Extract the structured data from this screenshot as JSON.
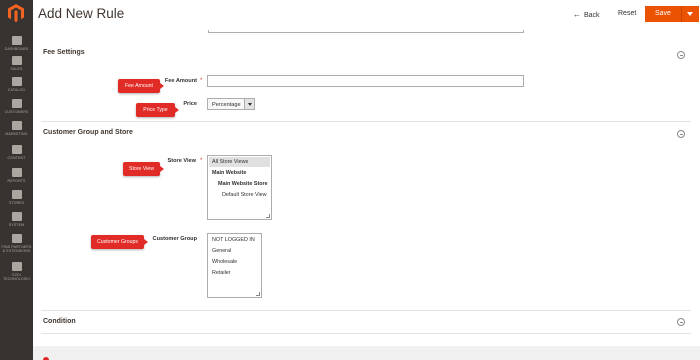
{
  "sidebar": {
    "items": [
      {
        "label": "Dashboard",
        "icon": "dashboard-icon"
      },
      {
        "label": "Sales",
        "icon": "dollar-icon"
      },
      {
        "label": "Catalog",
        "icon": "box-icon"
      },
      {
        "label": "Customers",
        "icon": "user-icon"
      },
      {
        "label": "Marketing",
        "icon": "megaphone-icon"
      },
      {
        "label": "Content",
        "icon": "layout-icon"
      },
      {
        "label": "Reports",
        "icon": "bar-chart-icon"
      },
      {
        "label": "Stores",
        "icon": "store-icon"
      },
      {
        "label": "System",
        "icon": "gear-icon"
      },
      {
        "label": "Find Partners & Extensions",
        "icon": "puzzle-icon"
      },
      {
        "label": "Ezdi Technoloski",
        "icon": "user-circle-icon"
      }
    ]
  },
  "header": {
    "title": "Add New Rule",
    "back_label": "Back",
    "reset_label": "Reset",
    "save_label": "Save"
  },
  "fee_settings": {
    "title": "Fee Settings",
    "fee_amount_label": "Fee Amount",
    "fee_amount_value": "",
    "price_type_label": "Price",
    "price_type_value": "Percentage",
    "fee_amount_tooltip": "Fee Amount",
    "price_type_tooltip": "Price Type"
  },
  "customer_group_store": {
    "title": "Customer Group and Store",
    "store_view_label": "Store View",
    "store_view_tooltip": "Store View",
    "store_view_options": [
      "All Store Views",
      "Main Website",
      "Main Website Store",
      "Default Store View"
    ],
    "customer_group_label": "Customer Group",
    "customer_group_tooltip": "Customer Groups",
    "customer_group_options": [
      "NOT LOGGED IN",
      "General",
      "Wholesale",
      "Retailer"
    ]
  },
  "condition": {
    "title": "Condition"
  },
  "colors": {
    "sidebar_bg": "#373330",
    "accent": "#eb5202",
    "tooltip": "#e02b27",
    "required": "#e22626"
  }
}
